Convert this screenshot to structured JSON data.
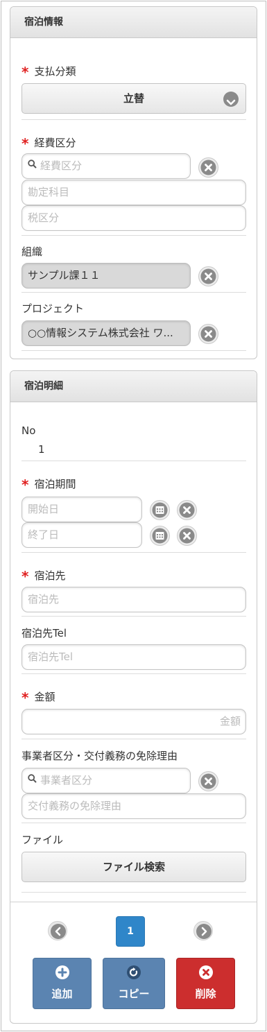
{
  "lodging_info": {
    "title": "宿泊情報",
    "payment_type": {
      "label": "支払分類",
      "value": "立替"
    },
    "expense_category": {
      "label": "経費区分",
      "search_placeholder": "経費区分",
      "account_placeholder": "勘定科目",
      "tax_placeholder": "税区分"
    },
    "organization": {
      "label": "組織",
      "value": "サンプル課１１"
    },
    "project": {
      "label": "プロジェクト",
      "value": "○○情報システム株式会社 ワ..."
    }
  },
  "lodging_detail": {
    "title": "宿泊明細",
    "no": {
      "label": "No",
      "value": "1"
    },
    "period": {
      "label": "宿泊期間",
      "start_placeholder": "開始日",
      "end_placeholder": "終了日"
    },
    "destination": {
      "label": "宿泊先",
      "placeholder": "宿泊先"
    },
    "destination_tel": {
      "label": "宿泊先Tel",
      "placeholder": "宿泊先Tel"
    },
    "amount": {
      "label": "金額",
      "placeholder": "金額"
    },
    "business_class": {
      "label": "事業者区分・交付義務の免除理由",
      "search_placeholder": "事業者区分",
      "reason_placeholder": "交付義務の免除理由"
    },
    "file": {
      "label": "ファイル",
      "button": "ファイル検索"
    }
  },
  "pager": {
    "current_page": "1"
  },
  "actions": {
    "add": {
      "label": "追加",
      "color": "#5b84b1"
    },
    "copy": {
      "label": "コピー",
      "color": "#5b84b1"
    },
    "delete": {
      "label": "削除",
      "color": "#cc2e2e"
    }
  }
}
